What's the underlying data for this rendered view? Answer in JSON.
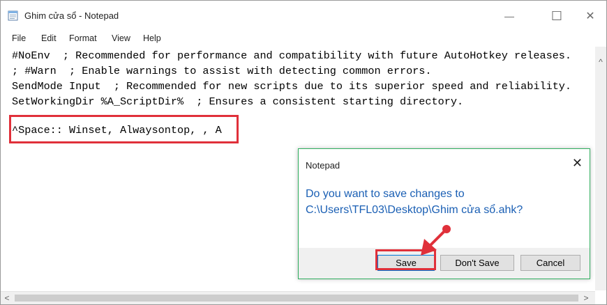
{
  "window": {
    "title": "Ghim cửa sổ - Notepad",
    "minimize_glyph": "—",
    "maximize_glyph": "☐",
    "close_glyph": "✕"
  },
  "menu": {
    "items": [
      "File",
      "Edit",
      "Format",
      "View",
      "Help"
    ]
  },
  "editor": {
    "lines": [
      "#NoEnv  ; Recommended for performance and compatibility with future AutoHotkey releases.",
      "; #Warn  ; Enable warnings to assist with detecting common errors.",
      "SendMode Input  ; Recommended for new scripts due to its superior speed and reliability.",
      "SetWorkingDir %A_ScriptDir%  ; Ensures a consistent starting directory.",
      "",
      "^Space:: Winset, Alwaysontop, , A"
    ]
  },
  "dialog": {
    "title": "Notepad",
    "close_glyph": "✕",
    "message_line1": "Do you want to save changes to",
    "message_line2": "C:\\Users\\TFL03\\Desktop\\Ghim cửa sổ.ahk?",
    "save_label": "Save",
    "dont_save_label": "Don't Save",
    "cancel_label": "Cancel"
  },
  "scroll": {
    "left_arrow": "<",
    "right_arrow": ">",
    "up_arrow": "^"
  },
  "icons": {
    "app": "notepad-icon",
    "annotation_arrow": "red-arrow-icon"
  },
  "colors": {
    "annotation_red": "#e0303a",
    "message_blue": "#1a5fb4",
    "dialog_border": "#2fae5e"
  }
}
